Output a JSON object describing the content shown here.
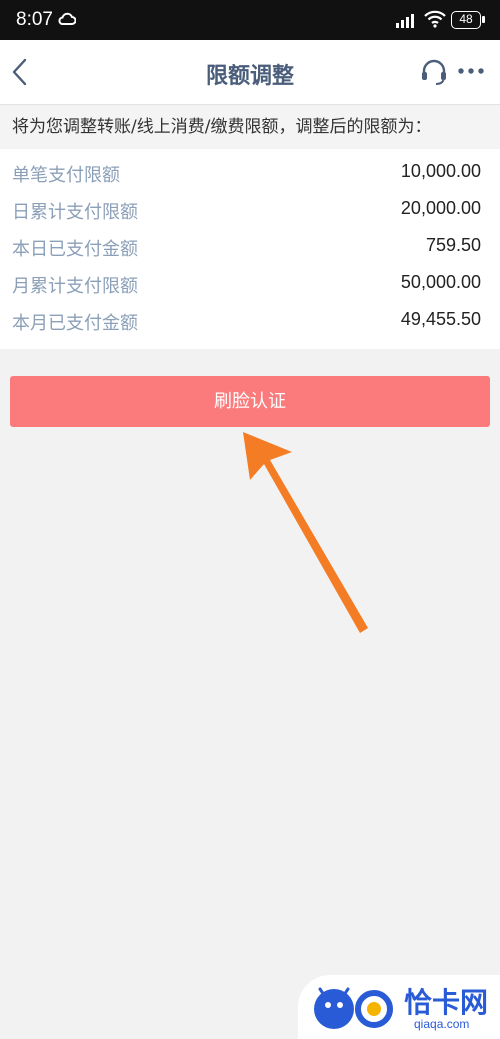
{
  "status_bar": {
    "time": "8:07",
    "battery": "48"
  },
  "nav": {
    "title": "限额调整",
    "icons": [
      "back-icon",
      "headset-icon",
      "more-icon"
    ]
  },
  "notice": "将为您调整转账/线上消费/缴费限额，调整后的限额为：",
  "limits": [
    {
      "label": "单笔支付限额",
      "value": "10,000.00"
    },
    {
      "label": "日累计支付限额",
      "value": "20,000.00"
    },
    {
      "label": "本日已支付金额",
      "value": "759.50"
    },
    {
      "label": "月累计支付限额",
      "value": "50,000.00"
    },
    {
      "label": "本月已支付金额",
      "value": "49,455.50"
    }
  ],
  "action_button": "刷脸认证",
  "annotation": {
    "type": "arrow",
    "color": "#f47c25"
  },
  "watermark": {
    "name": "恰卡网",
    "domain": "qiaqa.com"
  },
  "colors": {
    "accent_button": "#fb7a7b",
    "title_text": "#4a5d7a",
    "label_text": "#8ba0b8",
    "watermark_blue": "#2a5bd7"
  }
}
